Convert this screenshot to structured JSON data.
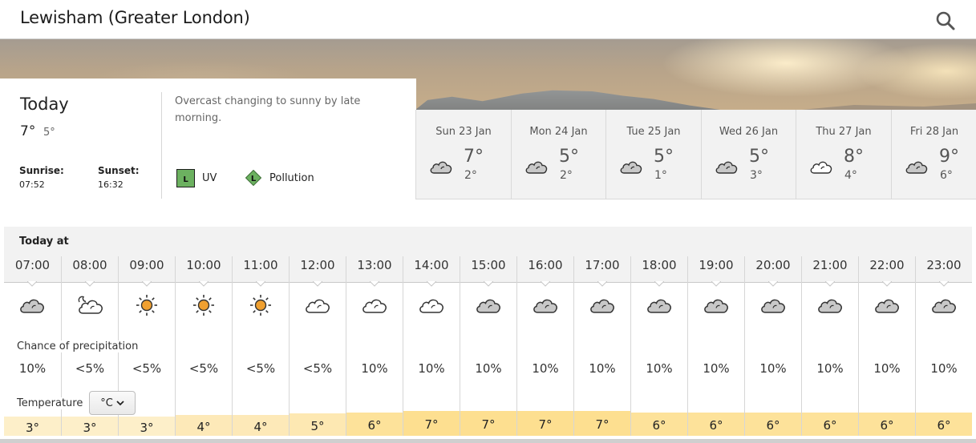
{
  "header": {
    "title": "Lewisham (Greater London)",
    "search_icon": "search-icon"
  },
  "today": {
    "title": "Today",
    "high": "7°",
    "low": "5°",
    "sunrise_label": "Sunrise:",
    "sunrise_time": "07:52",
    "sunset_label": "Sunset:",
    "sunset_time": "16:32",
    "summary": "Overcast changing to sunny by late morning.",
    "uv": {
      "level": "L",
      "label": "UV",
      "color": "#6cb160"
    },
    "pollution": {
      "level": "L",
      "label": "Pollution",
      "color": "#6cb160"
    }
  },
  "days": [
    {
      "name": "Sun 23 Jan",
      "high": "7°",
      "low": "2°",
      "icon": "cloud-grey-icon"
    },
    {
      "name": "Mon 24 Jan",
      "high": "5°",
      "low": "2°",
      "icon": "cloud-grey-icon"
    },
    {
      "name": "Tue 25 Jan",
      "high": "5°",
      "low": "1°",
      "icon": "cloud-grey-icon"
    },
    {
      "name": "Wed 26 Jan",
      "high": "5°",
      "low": "3°",
      "icon": "cloud-grey-icon"
    },
    {
      "name": "Thu 27 Jan",
      "high": "8°",
      "low": "4°",
      "icon": "cloud-white-icon"
    },
    {
      "name": "Fri 28 Jan",
      "high": "9°",
      "low": "6°",
      "icon": "cloud-grey-icon"
    }
  ],
  "hourly": {
    "title": "Today at",
    "precip_label": "Chance of precipitation",
    "temp_label": "Temperature",
    "unit": "°C",
    "hours": [
      {
        "time": "07:00",
        "icon": "cloud-grey-icon",
        "precip": "10%",
        "temp": "3°",
        "temp_value": 3
      },
      {
        "time": "08:00",
        "icon": "partly-cloudy-night-icon",
        "precip": "<5%",
        "temp": "3°",
        "temp_value": 3
      },
      {
        "time": "09:00",
        "icon": "sun-icon",
        "precip": "<5%",
        "temp": "3°",
        "temp_value": 3
      },
      {
        "time": "10:00",
        "icon": "sun-icon",
        "precip": "<5%",
        "temp": "4°",
        "temp_value": 4
      },
      {
        "time": "11:00",
        "icon": "sun-icon",
        "precip": "<5%",
        "temp": "4°",
        "temp_value": 4
      },
      {
        "time": "12:00",
        "icon": "cloud-white-icon",
        "precip": "<5%",
        "temp": "5°",
        "temp_value": 5
      },
      {
        "time": "13:00",
        "icon": "cloud-white-icon",
        "precip": "10%",
        "temp": "6°",
        "temp_value": 6
      },
      {
        "time": "14:00",
        "icon": "cloud-white-icon",
        "precip": "10%",
        "temp": "7°",
        "temp_value": 7
      },
      {
        "time": "15:00",
        "icon": "cloud-grey-icon",
        "precip": "10%",
        "temp": "7°",
        "temp_value": 7
      },
      {
        "time": "16:00",
        "icon": "cloud-grey-icon",
        "precip": "10%",
        "temp": "7°",
        "temp_value": 7
      },
      {
        "time": "17:00",
        "icon": "cloud-grey-icon",
        "precip": "10%",
        "temp": "7°",
        "temp_value": 7
      },
      {
        "time": "18:00",
        "icon": "cloud-grey-icon",
        "precip": "10%",
        "temp": "6°",
        "temp_value": 6
      },
      {
        "time": "19:00",
        "icon": "cloud-grey-icon",
        "precip": "10%",
        "temp": "6°",
        "temp_value": 6
      },
      {
        "time": "20:00",
        "icon": "cloud-grey-icon",
        "precip": "10%",
        "temp": "6°",
        "temp_value": 6
      },
      {
        "time": "21:00",
        "icon": "cloud-grey-icon",
        "precip": "10%",
        "temp": "6°",
        "temp_value": 6
      },
      {
        "time": "22:00",
        "icon": "cloud-grey-icon",
        "precip": "10%",
        "temp": "6°",
        "temp_value": 6
      },
      {
        "time": "23:00",
        "icon": "cloud-grey-icon",
        "precip": "10%",
        "temp": "6°",
        "temp_value": 6
      }
    ],
    "temp_colors": {
      "3": "#fdefc9",
      "4": "#fde9b8",
      "5": "#fde8b2",
      "6": "#fde29a",
      "7": "#fddf90"
    }
  }
}
